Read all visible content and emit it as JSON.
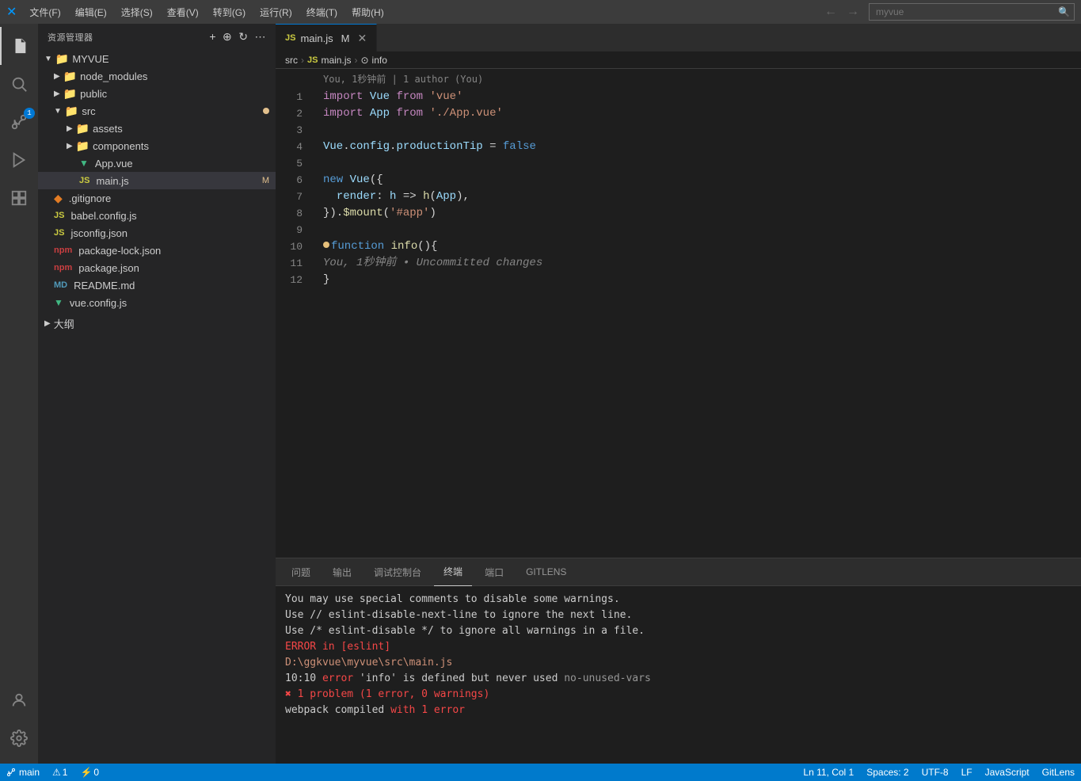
{
  "menubar": {
    "items": [
      "文件(F)",
      "编辑(E)",
      "选择(S)",
      "查看(V)",
      "转到(G)",
      "运行(R)",
      "终端(T)",
      "帮助(H)"
    ],
    "search_placeholder": "myvue",
    "nav_back": "←",
    "nav_forward": "→"
  },
  "activity_bar": {
    "icons": [
      {
        "name": "files-icon",
        "symbol": "⎘",
        "active": false
      },
      {
        "name": "search-icon",
        "symbol": "🔍",
        "active": false
      },
      {
        "name": "source-control-icon",
        "symbol": "⑂",
        "active": false,
        "badge": "1"
      },
      {
        "name": "run-icon",
        "symbol": "▷",
        "active": false
      },
      {
        "name": "extensions-icon",
        "symbol": "⊞",
        "active": false
      }
    ],
    "bottom": [
      {
        "name": "account-icon",
        "symbol": "👤"
      },
      {
        "name": "settings-icon",
        "symbol": "⚙"
      }
    ]
  },
  "sidebar": {
    "title": "资源管理器",
    "root": "MYVUE",
    "tree": [
      {
        "label": "node_modules",
        "type": "folder",
        "indent": 1,
        "collapsed": true,
        "icon_color": "#dcb67a"
      },
      {
        "label": "public",
        "type": "folder",
        "indent": 1,
        "collapsed": true,
        "icon_color": "#dcb67a"
      },
      {
        "label": "src",
        "type": "folder",
        "indent": 1,
        "collapsed": false,
        "icon_color": "#dcb67a",
        "modified": true
      },
      {
        "label": "assets",
        "type": "folder",
        "indent": 2,
        "collapsed": true,
        "icon_color": "#dcb67a"
      },
      {
        "label": "components",
        "type": "folder",
        "indent": 2,
        "collapsed": true,
        "icon_color": "#dcb67a"
      },
      {
        "label": "App.vue",
        "type": "file",
        "indent": 2,
        "icon_color": "#41b883",
        "icon": "V"
      },
      {
        "label": "main.js",
        "type": "file",
        "indent": 2,
        "icon_color": "#cbcb41",
        "active": true,
        "badge": "M"
      },
      {
        "label": ".gitignore",
        "type": "file",
        "indent": 1,
        "icon_color": "#e37c24"
      },
      {
        "label": "babel.config.js",
        "type": "file",
        "indent": 1,
        "icon_color": "#cbcb41"
      },
      {
        "label": "jsconfig.json",
        "type": "file",
        "indent": 1,
        "icon_color": "#cbcb41"
      },
      {
        "label": "package-lock.json",
        "type": "file",
        "indent": 1,
        "icon_color": "#cb3f41"
      },
      {
        "label": "package.json",
        "type": "file",
        "indent": 1,
        "icon_color": "#cb3f41"
      },
      {
        "label": "README.md",
        "type": "file",
        "indent": 1,
        "icon_color": "#519aba"
      },
      {
        "label": "vue.config.js",
        "type": "file",
        "indent": 1,
        "icon_color": "#41b883",
        "icon": "V"
      }
    ],
    "bottom_section": "大纲"
  },
  "tabs": [
    {
      "label": "main.js",
      "modified": true,
      "active": true,
      "lang_icon": "JS",
      "lang_color": "#cbcb41"
    }
  ],
  "breadcrumb": {
    "items": [
      "src",
      "JS main.js",
      "⊙ info"
    ]
  },
  "git_blame": "You, 1秒钟前 | 1 author (You)",
  "code": {
    "lines": [
      {
        "num": 1,
        "tokens": [
          {
            "t": "import",
            "c": "kw-import"
          },
          {
            "t": " Vue ",
            "c": ""
          },
          {
            "t": "from",
            "c": "kw-import"
          },
          {
            "t": " ",
            "c": ""
          },
          {
            "t": "'vue'",
            "c": "str"
          }
        ]
      },
      {
        "num": 2,
        "tokens": [
          {
            "t": "import",
            "c": "kw-import"
          },
          {
            "t": " App ",
            "c": ""
          },
          {
            "t": "from",
            "c": "kw-import"
          },
          {
            "t": " ",
            "c": ""
          },
          {
            "t": "'./App.vue'",
            "c": "str"
          }
        ]
      },
      {
        "num": 3,
        "tokens": []
      },
      {
        "num": 4,
        "tokens": [
          {
            "t": "Vue",
            "c": "var"
          },
          {
            "t": ".",
            "c": ""
          },
          {
            "t": "config",
            "c": "prop"
          },
          {
            "t": ".",
            "c": ""
          },
          {
            "t": "productionTip",
            "c": "prop"
          },
          {
            "t": " = ",
            "c": ""
          },
          {
            "t": "false",
            "c": "bool"
          }
        ]
      },
      {
        "num": 5,
        "tokens": []
      },
      {
        "num": 6,
        "tokens": [
          {
            "t": "new",
            "c": "kw"
          },
          {
            "t": " ",
            "c": ""
          },
          {
            "t": "Vue",
            "c": "var"
          },
          {
            "t": "({",
            "c": ""
          }
        ]
      },
      {
        "num": 7,
        "tokens": [
          {
            "t": "  render",
            "c": "prop"
          },
          {
            "t": ": ",
            "c": ""
          },
          {
            "t": "h",
            "c": "var"
          },
          {
            "t": " => ",
            "c": ""
          },
          {
            "t": "h",
            "c": "fn-name"
          },
          {
            "t": "(",
            "c": ""
          },
          {
            "t": "App",
            "c": "var"
          },
          {
            "t": ")",
            "c": ""
          },
          {
            "t": ",",
            "c": ""
          }
        ]
      },
      {
        "num": 8,
        "tokens": [
          {
            "t": "}).",
            "c": ""
          },
          {
            "t": "$mount",
            "c": "fn-name"
          },
          {
            "t": "(",
            "c": ""
          },
          {
            "t": "'#app'",
            "c": "str"
          },
          {
            "t": ")",
            "c": ""
          }
        ]
      },
      {
        "num": 9,
        "tokens": []
      },
      {
        "num": 10,
        "tokens": [
          {
            "t": "function",
            "c": "kw"
          },
          {
            "t": " ",
            "c": ""
          },
          {
            "t": "info",
            "c": "fn-name"
          },
          {
            "t": "(){",
            "c": ""
          }
        ],
        "yellow_dot": true
      },
      {
        "num": 11,
        "tokens": [],
        "ghost": "You, 1秒钟前 • Uncommitted changes"
      },
      {
        "num": 12,
        "tokens": [
          {
            "t": "}",
            "c": ""
          }
        ]
      }
    ]
  },
  "panel": {
    "tabs": [
      "问题",
      "输出",
      "调试控制台",
      "终端",
      "端口",
      "GITLENS"
    ],
    "active_tab": "终端",
    "terminal_lines": [
      {
        "text": "You may use special comments to disable some warnings.",
        "class": ""
      },
      {
        "text": "Use // eslint-disable-next-line to ignore the next line.",
        "class": ""
      },
      {
        "text": "Use /* eslint-disable */ to ignore all warnings in a file.",
        "class": ""
      },
      {
        "text": "ERROR in [eslint]",
        "class": "error-text"
      },
      {
        "text": "D:\\ggkvue\\myvue\\src\\main.js",
        "class": "error-path"
      },
      {
        "text": "  10:10  error  'info' is defined but never used  no-unused-vars",
        "class": ""
      },
      {
        "text": "",
        "class": ""
      },
      {
        "text": "✖ 1 problem (1 error, 0 warnings)",
        "class": "error-summary"
      },
      {
        "text": "",
        "class": ""
      },
      {
        "text": "webpack compiled with 1 error",
        "class": ""
      }
    ]
  },
  "status_bar": {
    "left": [
      "⎇ main",
      "⚠ 1",
      "⚡ 0"
    ],
    "right": [
      "Ln 11, Col 1",
      "Spaces: 2",
      "UTF-8",
      "LF",
      "JavaScript",
      "GitLens"
    ]
  }
}
